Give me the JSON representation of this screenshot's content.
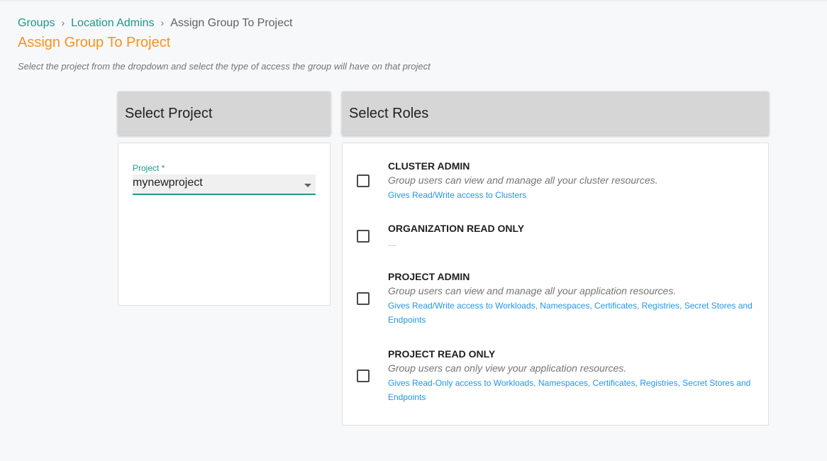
{
  "breadcrumb": {
    "items": [
      "Groups",
      "Location Admins"
    ],
    "separator": "›",
    "current": "Assign Group To Project"
  },
  "page": {
    "title": "Assign Group To Project",
    "subtitle": "Select the project from the dropdown and select the type of access the group will have on that project"
  },
  "project_panel": {
    "header": "Select Project",
    "field_label": "Project *",
    "selected_value": "mynewproject"
  },
  "roles_panel": {
    "header": "Select Roles",
    "roles": [
      {
        "name": "CLUSTER ADMIN",
        "description": "Group users can view and manage all your cluster resources.",
        "access": "Gives Read/Write access to Clusters",
        "checked": false
      },
      {
        "name": "ORGANIZATION READ ONLY",
        "description": "...",
        "access": "",
        "checked": false
      },
      {
        "name": "PROJECT ADMIN",
        "description": "Group users can view and manage all your application resources.",
        "access": "Gives Read/Write access to Workloads, Namespaces, Certificates, Registries, Secret Stores and Endpoints",
        "checked": false
      },
      {
        "name": "PROJECT READ ONLY",
        "description": "Group users can only view your application resources.",
        "access": "Gives Read-Only access to Workloads, Namespaces, Certificates, Registries, Secret Stores and Endpoints",
        "checked": false
      }
    ]
  },
  "colors": {
    "link": "#1b9a8a",
    "title": "#f7931e",
    "access_text": "#2196f3",
    "panel_header_bg": "#d6d6d6"
  }
}
